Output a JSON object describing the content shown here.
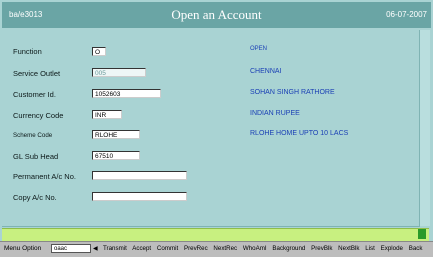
{
  "titlebar": {
    "left": "ba/e3013",
    "title": "Open an Account",
    "date": "06-07-2007"
  },
  "form": {
    "function": {
      "label": "Function",
      "value": "O",
      "desc": "OPEN"
    },
    "service_outlet": {
      "label": "Service Outlet",
      "value": "005",
      "desc": "CHENNAI"
    },
    "customer_id": {
      "label": "Customer Id.",
      "value": "1052603",
      "desc": "SOHAN SINGH RATHORE"
    },
    "currency_code": {
      "label": "Currency Code",
      "value": "INR",
      "desc": "INDIAN RUPEE"
    },
    "scheme_code": {
      "label": "Scheme Code",
      "value": "RLOHE",
      "desc": "RLOHE HOME UPTO 10 LACS"
    },
    "gl_sub_head": {
      "label": "GL Sub Head",
      "value": "67510"
    },
    "permanent_ac": {
      "label": "Permanent A/c No.",
      "value": ""
    },
    "copy_ac": {
      "label": "Copy A/c No.",
      "value": ""
    }
  },
  "menubar": {
    "label": "Menu Option",
    "input_value": "oaac",
    "buttons": [
      "Transmit",
      "Accept",
      "Commit",
      "PrevRec",
      "NextRec",
      "WhoAmI",
      "Background",
      "PrevBlk",
      "NextBlk",
      "List",
      "Explode",
      "Back"
    ]
  }
}
